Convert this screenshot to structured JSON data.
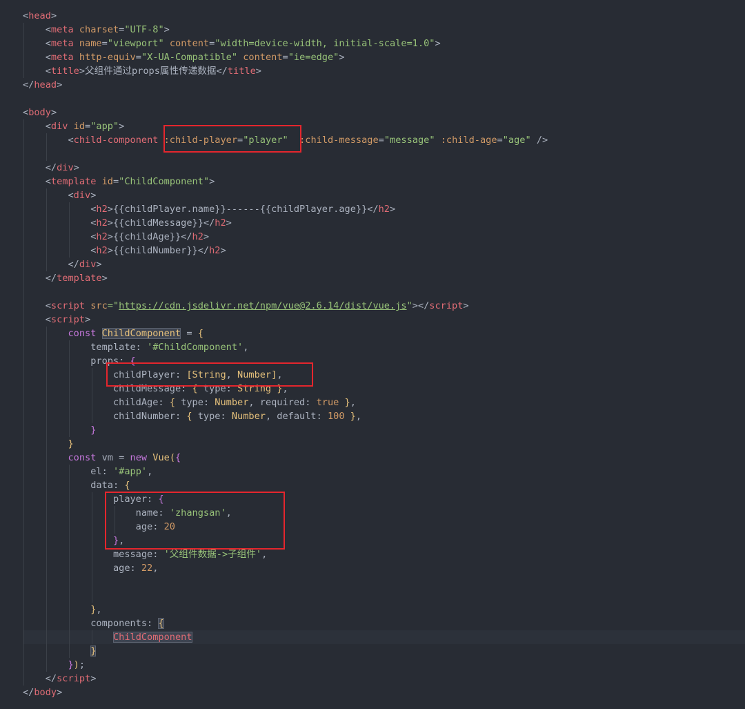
{
  "editor": {
    "colors": {
      "background": "#282c34",
      "tag": "#e06c75",
      "attribute": "#d19a66",
      "string": "#98c379",
      "keyword": "#c678dd",
      "type": "#e5c07b",
      "number": "#d19a66",
      "plain": "#abb2bf",
      "highlight_box": "#e5262d"
    },
    "lines": [
      [
        {
          "t": "<",
          "c": "plain"
        },
        {
          "t": "head",
          "c": "tag"
        },
        {
          "t": ">",
          "c": "plain"
        }
      ],
      [
        {
          "t": "    <",
          "c": "plain"
        },
        {
          "t": "meta",
          "c": "tag"
        },
        {
          "t": " ",
          "c": "plain"
        },
        {
          "t": "charset",
          "c": "attr"
        },
        {
          "t": "=",
          "c": "plain"
        },
        {
          "t": "\"UTF-8\"",
          "c": "str"
        },
        {
          "t": ">",
          "c": "plain"
        }
      ],
      [
        {
          "t": "    <",
          "c": "plain"
        },
        {
          "t": "meta",
          "c": "tag"
        },
        {
          "t": " ",
          "c": "plain"
        },
        {
          "t": "name",
          "c": "attr"
        },
        {
          "t": "=",
          "c": "plain"
        },
        {
          "t": "\"viewport\"",
          "c": "str"
        },
        {
          "t": " ",
          "c": "plain"
        },
        {
          "t": "content",
          "c": "attr"
        },
        {
          "t": "=",
          "c": "plain"
        },
        {
          "t": "\"width=device-width, initial-scale=1.0\"",
          "c": "str"
        },
        {
          "t": ">",
          "c": "plain"
        }
      ],
      [
        {
          "t": "    <",
          "c": "plain"
        },
        {
          "t": "meta",
          "c": "tag"
        },
        {
          "t": " ",
          "c": "plain"
        },
        {
          "t": "http-equiv",
          "c": "attr"
        },
        {
          "t": "=",
          "c": "plain"
        },
        {
          "t": "\"X-UA-Compatible\"",
          "c": "str"
        },
        {
          "t": " ",
          "c": "plain"
        },
        {
          "t": "content",
          "c": "attr"
        },
        {
          "t": "=",
          "c": "plain"
        },
        {
          "t": "\"ie=edge\"",
          "c": "str"
        },
        {
          "t": ">",
          "c": "plain"
        }
      ],
      [
        {
          "t": "    <",
          "c": "plain"
        },
        {
          "t": "title",
          "c": "tag"
        },
        {
          "t": ">父组件通过props属性传递数据</",
          "c": "plain"
        },
        {
          "t": "title",
          "c": "tag"
        },
        {
          "t": ">",
          "c": "plain"
        }
      ],
      [
        {
          "t": "</",
          "c": "plain"
        },
        {
          "t": "head",
          "c": "tag"
        },
        {
          "t": ">",
          "c": "plain"
        }
      ],
      [],
      [
        {
          "t": "<",
          "c": "plain"
        },
        {
          "t": "body",
          "c": "tag"
        },
        {
          "t": ">",
          "c": "plain"
        }
      ],
      [
        {
          "t": "    <",
          "c": "plain"
        },
        {
          "t": "div",
          "c": "tag"
        },
        {
          "t": " ",
          "c": "plain"
        },
        {
          "t": "id",
          "c": "attr"
        },
        {
          "t": "=",
          "c": "plain"
        },
        {
          "t": "\"app\"",
          "c": "str"
        },
        {
          "t": ">",
          "c": "plain"
        }
      ],
      [
        {
          "t": "        <",
          "c": "plain"
        },
        {
          "t": "child-component",
          "c": "tag"
        },
        {
          "t": " ",
          "c": "plain"
        },
        {
          "t": ":child-player",
          "c": "attr"
        },
        {
          "t": "=",
          "c": "plain"
        },
        {
          "t": "\"player\"",
          "c": "str"
        },
        {
          "t": "  ",
          "c": "plain"
        },
        {
          "t": ":child-message",
          "c": "attr"
        },
        {
          "t": "=",
          "c": "plain"
        },
        {
          "t": "\"message\"",
          "c": "str"
        },
        {
          "t": " ",
          "c": "plain"
        },
        {
          "t": ":child-age",
          "c": "attr"
        },
        {
          "t": "=",
          "c": "plain"
        },
        {
          "t": "\"age\"",
          "c": "str"
        },
        {
          "t": " />",
          "c": "plain"
        }
      ],
      [],
      [
        {
          "t": "    </",
          "c": "plain"
        },
        {
          "t": "div",
          "c": "tag"
        },
        {
          "t": ">",
          "c": "plain"
        }
      ],
      [
        {
          "t": "    <",
          "c": "plain"
        },
        {
          "t": "template",
          "c": "tag"
        },
        {
          "t": " ",
          "c": "plain"
        },
        {
          "t": "id",
          "c": "attr"
        },
        {
          "t": "=",
          "c": "plain"
        },
        {
          "t": "\"ChildComponent\"",
          "c": "str"
        },
        {
          "t": ">",
          "c": "plain"
        }
      ],
      [
        {
          "t": "        <",
          "c": "plain"
        },
        {
          "t": "div",
          "c": "tag"
        },
        {
          "t": ">",
          "c": "plain"
        }
      ],
      [
        {
          "t": "            <",
          "c": "plain"
        },
        {
          "t": "h2",
          "c": "tag"
        },
        {
          "t": ">{{childPlayer.name}}------{{childPlayer.age}}</",
          "c": "plain"
        },
        {
          "t": "h2",
          "c": "tag"
        },
        {
          "t": ">",
          "c": "plain"
        }
      ],
      [
        {
          "t": "            <",
          "c": "plain"
        },
        {
          "t": "h2",
          "c": "tag"
        },
        {
          "t": ">{{childMessage}}</",
          "c": "plain"
        },
        {
          "t": "h2",
          "c": "tag"
        },
        {
          "t": ">",
          "c": "plain"
        }
      ],
      [
        {
          "t": "            <",
          "c": "plain"
        },
        {
          "t": "h2",
          "c": "tag"
        },
        {
          "t": ">{{childAge}}</",
          "c": "plain"
        },
        {
          "t": "h2",
          "c": "tag"
        },
        {
          "t": ">",
          "c": "plain"
        }
      ],
      [
        {
          "t": "            <",
          "c": "plain"
        },
        {
          "t": "h2",
          "c": "tag"
        },
        {
          "t": ">{{childNumber}}</",
          "c": "plain"
        },
        {
          "t": "h2",
          "c": "tag"
        },
        {
          "t": ">",
          "c": "plain"
        }
      ],
      [
        {
          "t": "        </",
          "c": "plain"
        },
        {
          "t": "div",
          "c": "tag"
        },
        {
          "t": ">",
          "c": "plain"
        }
      ],
      [
        {
          "t": "    </",
          "c": "plain"
        },
        {
          "t": "template",
          "c": "tag"
        },
        {
          "t": ">",
          "c": "plain"
        }
      ],
      [],
      [
        {
          "t": "    <",
          "c": "plain"
        },
        {
          "t": "script",
          "c": "tag"
        },
        {
          "t": " ",
          "c": "plain"
        },
        {
          "t": "src",
          "c": "attr"
        },
        {
          "t": "=\"",
          "c": "str"
        },
        {
          "t": "https://cdn.jsdelivr.net/npm/vue@2.6.14/dist/vue.js",
          "c": "url"
        },
        {
          "t": "\"",
          "c": "str"
        },
        {
          "t": "></",
          "c": "plain"
        },
        {
          "t": "script",
          "c": "tag"
        },
        {
          "t": ">",
          "c": "plain"
        }
      ],
      [
        {
          "t": "    <",
          "c": "plain"
        },
        {
          "t": "script",
          "c": "tag"
        },
        {
          "t": ">",
          "c": "plain"
        }
      ],
      [
        {
          "t": "        ",
          "c": "plain"
        },
        {
          "t": "const",
          "c": "kw"
        },
        {
          "t": " ",
          "c": "plain"
        },
        {
          "t": "ChildComponent",
          "c": "fn",
          "sel": true
        },
        {
          "t": " = ",
          "c": "plain"
        },
        {
          "t": "{",
          "c": "bracket"
        }
      ],
      [
        {
          "t": "            template: ",
          "c": "plain"
        },
        {
          "t": "'#ChildComponent'",
          "c": "str"
        },
        {
          "t": ",",
          "c": "plain"
        }
      ],
      [
        {
          "t": "            props: ",
          "c": "plain"
        },
        {
          "t": "{",
          "c": "kw"
        }
      ],
      [
        {
          "t": "                childPlayer: ",
          "c": "plain"
        },
        {
          "t": "[",
          "c": "bracket"
        },
        {
          "t": "String",
          "c": "fn"
        },
        {
          "t": ", ",
          "c": "plain"
        },
        {
          "t": "Number",
          "c": "fn"
        },
        {
          "t": "]",
          "c": "bracket"
        },
        {
          "t": ",",
          "c": "plain"
        }
      ],
      [
        {
          "t": "                childMessage: ",
          "c": "plain"
        },
        {
          "t": "{",
          "c": "bracket"
        },
        {
          "t": " type: ",
          "c": "plain"
        },
        {
          "t": "String",
          "c": "fn"
        },
        {
          "t": " ",
          "c": "plain"
        },
        {
          "t": "}",
          "c": "bracket"
        },
        {
          "t": ",",
          "c": "plain"
        }
      ],
      [
        {
          "t": "                childAge: ",
          "c": "plain"
        },
        {
          "t": "{",
          "c": "bracket"
        },
        {
          "t": " type: ",
          "c": "plain"
        },
        {
          "t": "Number",
          "c": "fn"
        },
        {
          "t": ", required: ",
          "c": "plain"
        },
        {
          "t": "true",
          "c": "num"
        },
        {
          "t": " ",
          "c": "plain"
        },
        {
          "t": "}",
          "c": "bracket"
        },
        {
          "t": ",",
          "c": "plain"
        }
      ],
      [
        {
          "t": "                childNumber: ",
          "c": "plain"
        },
        {
          "t": "{",
          "c": "bracket"
        },
        {
          "t": " type: ",
          "c": "plain"
        },
        {
          "t": "Number",
          "c": "fn"
        },
        {
          "t": ", default: ",
          "c": "plain"
        },
        {
          "t": "100",
          "c": "num"
        },
        {
          "t": " ",
          "c": "plain"
        },
        {
          "t": "}",
          "c": "bracket"
        },
        {
          "t": ",",
          "c": "plain"
        }
      ],
      [
        {
          "t": "            ",
          "c": "plain"
        },
        {
          "t": "}",
          "c": "kw"
        }
      ],
      [
        {
          "t": "        ",
          "c": "plain"
        },
        {
          "t": "}",
          "c": "bracket"
        }
      ],
      [
        {
          "t": "        ",
          "c": "plain"
        },
        {
          "t": "const",
          "c": "kw"
        },
        {
          "t": " vm = ",
          "c": "plain"
        },
        {
          "t": "new",
          "c": "kw"
        },
        {
          "t": " ",
          "c": "plain"
        },
        {
          "t": "Vue",
          "c": "fn"
        },
        {
          "t": "(",
          "c": "bracket"
        },
        {
          "t": "{",
          "c": "kw"
        }
      ],
      [
        {
          "t": "            el: ",
          "c": "plain"
        },
        {
          "t": "'#app'",
          "c": "str"
        },
        {
          "t": ",",
          "c": "plain"
        }
      ],
      [
        {
          "t": "            data: ",
          "c": "plain"
        },
        {
          "t": "{",
          "c": "bracket"
        }
      ],
      [
        {
          "t": "                player: ",
          "c": "plain"
        },
        {
          "t": "{",
          "c": "kw"
        }
      ],
      [
        {
          "t": "                    name: ",
          "c": "plain"
        },
        {
          "t": "'zhangsan'",
          "c": "str"
        },
        {
          "t": ",",
          "c": "plain"
        }
      ],
      [
        {
          "t": "                    age: ",
          "c": "plain"
        },
        {
          "t": "20",
          "c": "num"
        }
      ],
      [
        {
          "t": "                ",
          "c": "plain"
        },
        {
          "t": "}",
          "c": "kw"
        },
        {
          "t": ",",
          "c": "plain"
        }
      ],
      [
        {
          "t": "                message: ",
          "c": "plain"
        },
        {
          "t": "'父组件数据->子组件'",
          "c": "str"
        },
        {
          "t": ",",
          "c": "plain"
        }
      ],
      [
        {
          "t": "                age: ",
          "c": "plain"
        },
        {
          "t": "22",
          "c": "num"
        },
        {
          "t": ",",
          "c": "plain"
        }
      ],
      [],
      [],
      [
        {
          "t": "            ",
          "c": "plain"
        },
        {
          "t": "}",
          "c": "bracket"
        },
        {
          "t": ",",
          "c": "plain"
        }
      ],
      [
        {
          "t": "            components: ",
          "c": "plain"
        },
        {
          "t": "{",
          "c": "bracket",
          "sel": true
        }
      ],
      [
        {
          "t": "                ",
          "c": "plain"
        },
        {
          "t": "ChildComponent",
          "c": "prop",
          "sel": true
        }
      ],
      [
        {
          "t": "            ",
          "c": "plain"
        },
        {
          "t": "}",
          "c": "bracket",
          "sel": true
        }
      ],
      [
        {
          "t": "        ",
          "c": "plain"
        },
        {
          "t": "}",
          "c": "kw"
        },
        {
          "t": ")",
          "c": "bracket"
        },
        {
          "t": ";",
          "c": "plain"
        }
      ],
      [
        {
          "t": "    </",
          "c": "plain"
        },
        {
          "t": "script",
          "c": "tag"
        },
        {
          "t": ">",
          "c": "plain"
        }
      ],
      [
        {
          "t": "</",
          "c": "plain"
        },
        {
          "t": "body",
          "c": "tag"
        },
        {
          "t": ">",
          "c": "plain"
        }
      ]
    ]
  }
}
